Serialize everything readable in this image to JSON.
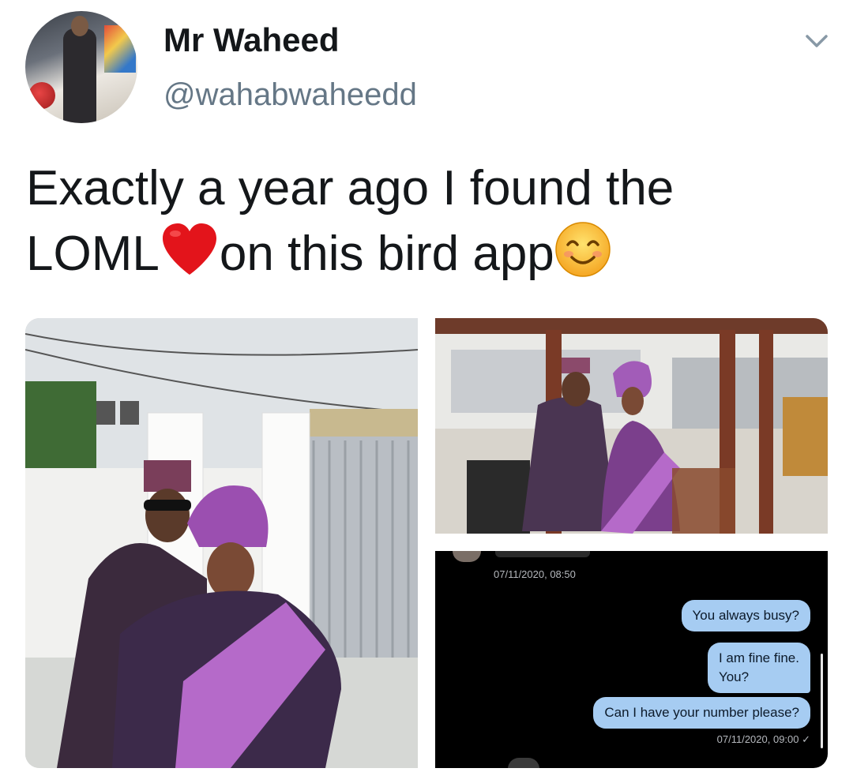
{
  "author": {
    "name": "Mr Waheed",
    "handle": "@wahabwaheedd"
  },
  "tweet": {
    "text_line1": "Exactly a year ago I found the",
    "text_line2_a": "LOML",
    "text_line2_b": "on this bird app",
    "emoji": [
      "red-heart",
      "smiling-face-with-smiling-eyes"
    ]
  },
  "media": {
    "photos": [
      {
        "name": "couple-outdoor-gate"
      },
      {
        "name": "couple-gazebo"
      },
      {
        "name": "chat-screenshot"
      }
    ],
    "chat": {
      "timestamp_top": "07/11/2020, 08:50",
      "messages": [
        {
          "text": "You always busy?"
        },
        {
          "text_line1": "I am fine fine.",
          "text_line2": "You?"
        },
        {
          "text": "Can I have your number please?"
        }
      ],
      "timestamp_bottom": "07/11/2020, 09:00 ✓"
    }
  },
  "colors": {
    "text_primary": "#14171a",
    "text_secondary": "#657786",
    "chat_bubble": "#a6ccf2",
    "chat_background": "#000000"
  }
}
